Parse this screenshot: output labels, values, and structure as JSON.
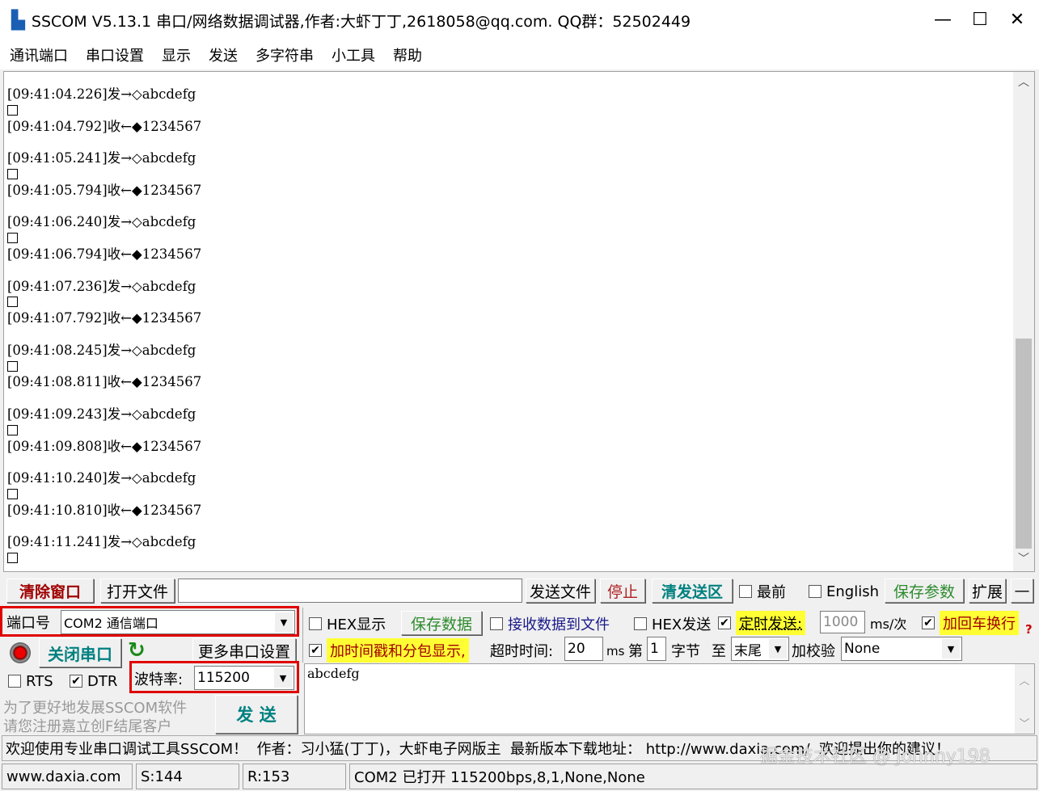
{
  "title": "SSCOM V5.13.1 串口/网络数据调试器,作者:大虾丁丁,2618058@qq.com. QQ群：52502449",
  "window_controls": {
    "minimize": "—",
    "maximize": "☐",
    "close": "✕"
  },
  "menu": [
    "通讯端口",
    "串口设置",
    "显示",
    "发送",
    "多字符串",
    "小工具",
    "帮助"
  ],
  "log": [
    {
      "time": "[09:41:04.226]",
      "dir": "发→◇",
      "data": "abcdefg",
      "send": true
    },
    {
      "time": "[09:41:04.792]",
      "dir": "收←◆",
      "data": "1234567",
      "send": false
    },
    {
      "time": "[09:41:05.241]",
      "dir": "发→◇",
      "data": "abcdefg",
      "send": true
    },
    {
      "time": "[09:41:05.794]",
      "dir": "收←◆",
      "data": "1234567",
      "send": false
    },
    {
      "time": "[09:41:06.240]",
      "dir": "发→◇",
      "data": "abcdefg",
      "send": true
    },
    {
      "time": "[09:41:06.794]",
      "dir": "收←◆",
      "data": "1234567",
      "send": false
    },
    {
      "time": "[09:41:07.236]",
      "dir": "发→◇",
      "data": "abcdefg",
      "send": true
    },
    {
      "time": "[09:41:07.792]",
      "dir": "收←◆",
      "data": "1234567",
      "send": false
    },
    {
      "time": "[09:41:08.245]",
      "dir": "发→◇",
      "data": "abcdefg",
      "send": true
    },
    {
      "time": "[09:41:08.811]",
      "dir": "收←◆",
      "data": "1234567",
      "send": false
    },
    {
      "time": "[09:41:09.243]",
      "dir": "发→◇",
      "data": "abcdefg",
      "send": true
    },
    {
      "time": "[09:41:09.808]",
      "dir": "收←◆",
      "data": "1234567",
      "send": false
    },
    {
      "time": "[09:41:10.240]",
      "dir": "发→◇",
      "data": "abcdefg",
      "send": true
    },
    {
      "time": "[09:41:10.810]",
      "dir": "收←◆",
      "data": "1234567",
      "send": false
    },
    {
      "time": "[09:41:11.241]",
      "dir": "发→◇",
      "data": "abcdefg",
      "send": true
    }
  ],
  "toolbar": {
    "clear": "清除窗口",
    "open_file": "打开文件",
    "file_path": "",
    "send_file": "发送文件",
    "stop": "停止",
    "clear_send": "清发送区",
    "topmost": "最前",
    "english": "English",
    "save_params": "保存参数",
    "expand": "扩展",
    "collapse": "—"
  },
  "port": {
    "label": "端口号",
    "value": "COM2 通信端口",
    "close_btn": "关闭串口",
    "more": "更多串口设置",
    "rts": "RTS",
    "dtr": "DTR",
    "baud_label": "波特率:",
    "baud": "115200",
    "promo1": "为了更好地发展SSCOM软件",
    "promo2": "请您注册嘉立创F结尾客户",
    "send_btn": "发  送"
  },
  "opts": {
    "hex_display": "HEX显示",
    "save_data": "保存数据",
    "recv_to_file": "接收数据到文件",
    "hex_send": "HEX发送",
    "timed_send": "定时发送:",
    "interval": "1000",
    "interval_unit": "ms/次",
    "add_crlf": "加回车换行",
    "timestamp": "加时间戳和分包显示,",
    "timeout_label": "超时时间:",
    "timeout": "20",
    "ms": "ms",
    "byte_from_label": "第",
    "byte_from": "1",
    "byte_label": "字节",
    "to_label": "至",
    "to_value": "末尾",
    "checksum_label": "加校验",
    "checksum": "None",
    "help": "?"
  },
  "send_text": "abcdefg",
  "welcome": "欢迎使用专业串口调试工具SSCOM！  作者：习小猛(丁丁)，大虾电子网版主  最新版本下载地址： http://www.daxia.com/  欢迎提出你的建议！",
  "watermark": "掘金技术社区 @ Johnny198",
  "status": {
    "site": "www.daxia.com",
    "sent": "S:144",
    "recv": "R:153",
    "port_state": "COM2 已打开  115200bps,8,1,None,None"
  },
  "colors": {
    "highlight": "#ffff33",
    "red_box": "#e00000",
    "green_text": "#2e8b2e",
    "teal_text": "#008080",
    "dark_red": "#a00000"
  }
}
